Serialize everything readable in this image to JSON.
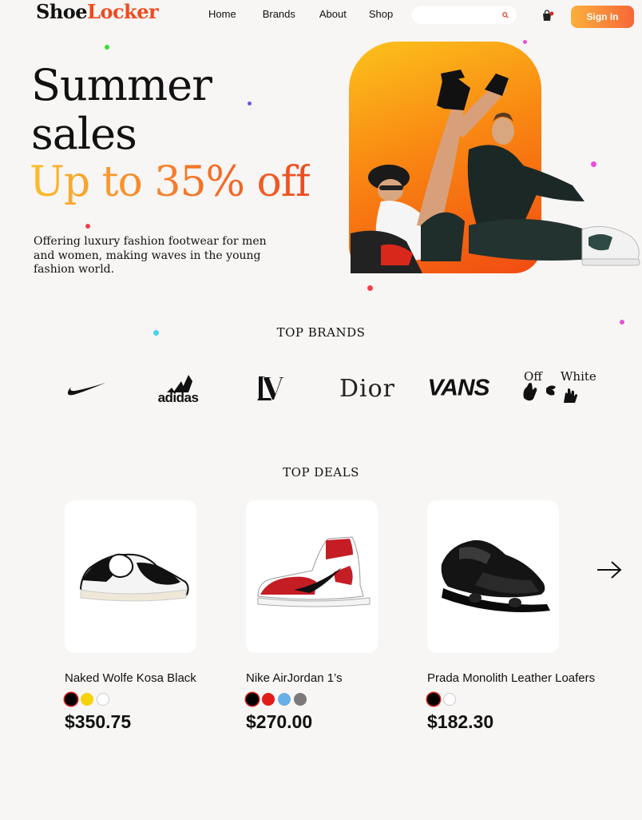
{
  "header": {
    "logo_part1": "Shoe",
    "logo_part2": "Locker",
    "nav": [
      "Home",
      "Brands",
      "About",
      "Shop"
    ],
    "search_placeholder": "",
    "signin_label": "Sign In"
  },
  "hero": {
    "title_line1": "Summer",
    "title_line2": "sales",
    "sale": "Up to 35% off",
    "description": "Offering luxury fashion footwear for men and women, making waves in the young fashion world."
  },
  "brands": {
    "title": "TOP BRANDS",
    "items": [
      {
        "name": "nike-logo"
      },
      {
        "label": "adidas"
      },
      {
        "name": "louis-vuitton-logo"
      },
      {
        "label": "Dior"
      },
      {
        "label": "VANS"
      },
      {
        "label1": "Off",
        "label2": "White"
      }
    ]
  },
  "deals": {
    "title": "TOP DEALS",
    "products": [
      {
        "name": "Naked Wolfe Kosa Black",
        "price": "$350.75",
        "colors": [
          "#000000",
          "#f5d20c",
          "#ffffff"
        ],
        "image": "black-white-sneaker-icon"
      },
      {
        "name": "Nike AirJordan 1’s",
        "price": "$270.00",
        "colors": [
          "#000000",
          "#e21b1b",
          "#6aaee6",
          "#7a7a7a"
        ],
        "image": "red-white-high-top-sneaker-icon"
      },
      {
        "name": "Prada Monolith Leather Loafers",
        "price": "$182.30",
        "colors": [
          "#000000",
          "#ffffff"
        ],
        "image": "black-leather-loafer-icon"
      }
    ]
  },
  "colors": {
    "accent_start": "#fbb03b",
    "accent_end": "#f04a1e"
  }
}
